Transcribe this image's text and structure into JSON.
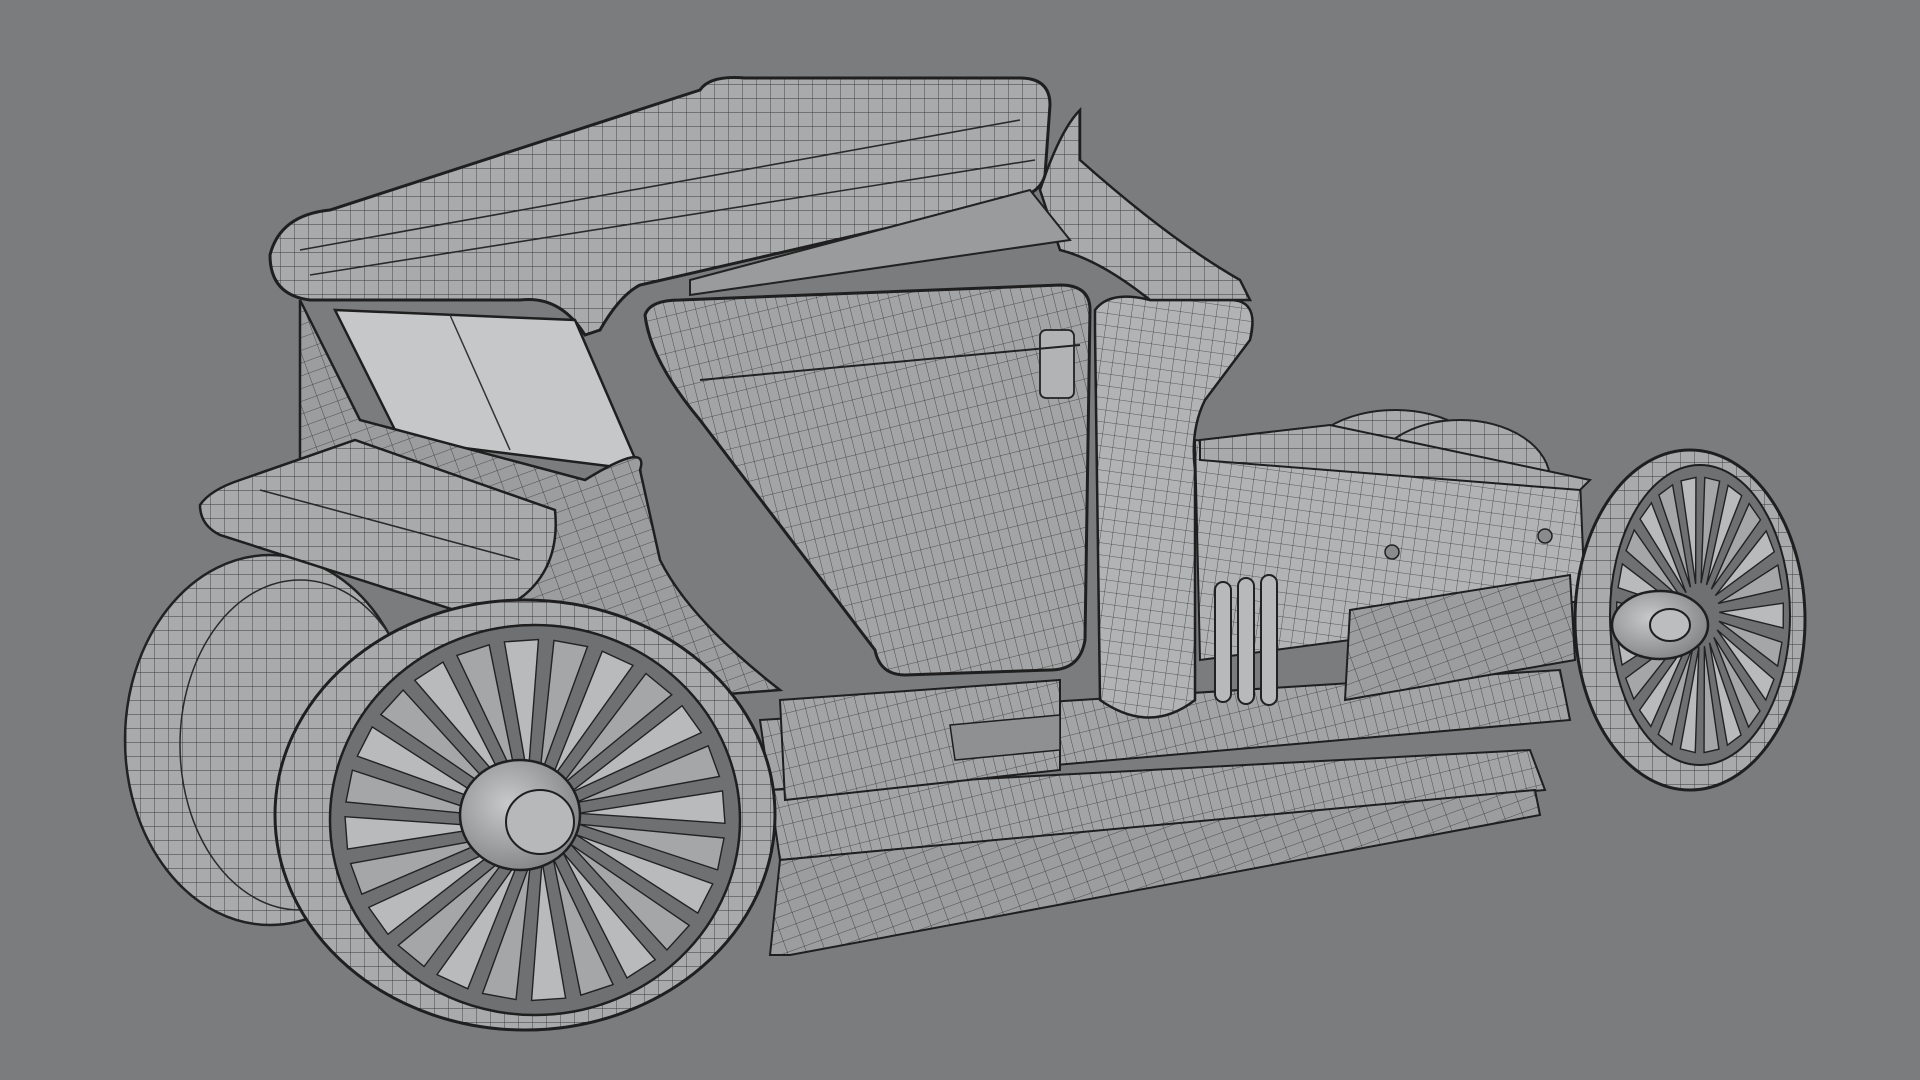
{
  "viewport": {
    "background": "#7b7c7e",
    "mode": "wireframe-on-shaded"
  },
  "model": {
    "subject": "hover-vehicle-concept",
    "surface_color": "#a9aaab",
    "surface_shadow": "#8e8f90",
    "surface_highlight": "#c4c5c6",
    "wire_color": "#2a2a2a",
    "glass_color": "#c9cacb"
  },
  "parts": [
    "canopy-roof",
    "front-fender",
    "windshield",
    "side-door",
    "rear-pillar",
    "engine-deck",
    "exhaust-vents",
    "lower-skirt",
    "front-left-turbine",
    "front-rear-turbine",
    "rear-right-turbine",
    "rear-hidden-turbine"
  ]
}
